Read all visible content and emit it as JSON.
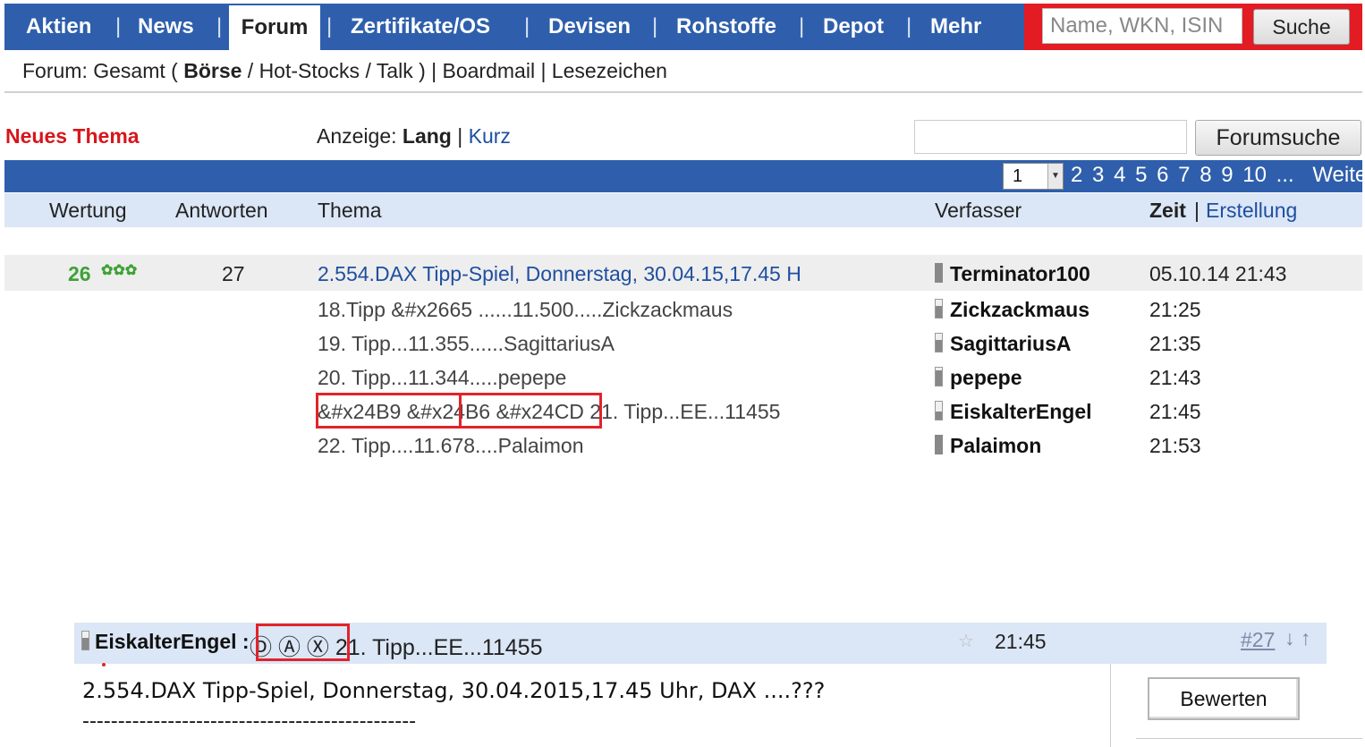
{
  "nav": {
    "items": [
      "Aktien",
      "News",
      "Forum",
      "Zertifikate/OS",
      "Devisen",
      "Rohstoffe",
      "Depot",
      "Mehr"
    ],
    "active": "Forum",
    "separator": "|",
    "search_placeholder": "Name, WKN, ISIN",
    "search_button": "Suche"
  },
  "subnav": {
    "prefix": "Forum: Gesamt (",
    "boerse": "Börse",
    "rest": "/ Hot-Stocks / Talk ) | Boardmail | Lesezeichen"
  },
  "toolbar": {
    "new_topic": "Neues Thema",
    "display_label": "Anzeige:",
    "display_long": "Lang",
    "display_sep": "|",
    "display_short": "Kurz",
    "forum_search_button": "Forumsuche"
  },
  "pagination": {
    "selected_page": "1",
    "pages": [
      "2",
      "3",
      "4",
      "5",
      "6",
      "7",
      "8",
      "9",
      "10",
      "..."
    ],
    "next_label": "Weiter",
    "next_icon": "play-right-icon"
  },
  "columns": {
    "rating": "Wertung",
    "replies": "Antworten",
    "topic": "Thema",
    "author": "Verfasser",
    "time": "Zeit",
    "time_sep": "|",
    "created": "Erstellung"
  },
  "thread": {
    "rating": "26",
    "rating_icon": "stars-icon",
    "replies": "27",
    "title": "2.554.DAX Tipp-Spiel, Donnerstag, 30.04.15,17.45 H",
    "author": "Terminator100",
    "time": "05.10.14 21:43"
  },
  "replies": [
    {
      "text": "18.Tipp &#x2665 ......11.500.....Zickzackmaus",
      "author": "Zickzackmaus",
      "time": "21:25"
    },
    {
      "text": "19. Tipp...11.355......SagittariusA",
      "author": "SagittariusA",
      "time": "21:35"
    },
    {
      "text": "20. Tipp...11.344.....pepepe",
      "author": "pepepe",
      "time": "21:43"
    },
    {
      "text": "&#x24B9 &#x24B6 &#x24CD 21. Tipp...EE...11455",
      "author": "EiskalterEngel",
      "time": "21:45"
    },
    {
      "text": "22. Tipp....11.678....Palaimon",
      "author": "Palaimon",
      "time": "21:53"
    }
  ],
  "post": {
    "author": "EiskalterEngel",
    "separator": ":",
    "title": "Ⓓ Ⓐ Ⓧ 21. Tipp...EE...11455",
    "star_icon": "star-outline-icon",
    "time": "21:45",
    "number": "#27",
    "arrows": "↓ ↑",
    "body_title": "2.554.DAX Tipp-Spiel, Donnerstag, 30.04.2015,17.45 Uhr, DAX ....???",
    "body_rule": "-----------------------------------------------",
    "rate_button": "Bewerten"
  },
  "colors": {
    "nav_blue": "#2f5fac",
    "header_light_blue": "#dbe6f6",
    "search_red": "#e31b23",
    "new_topic_red": "#d7161c",
    "link_blue": "#1f4fa0",
    "rating_green": "#3ea236",
    "highlight_box_red": "#e2232a"
  }
}
